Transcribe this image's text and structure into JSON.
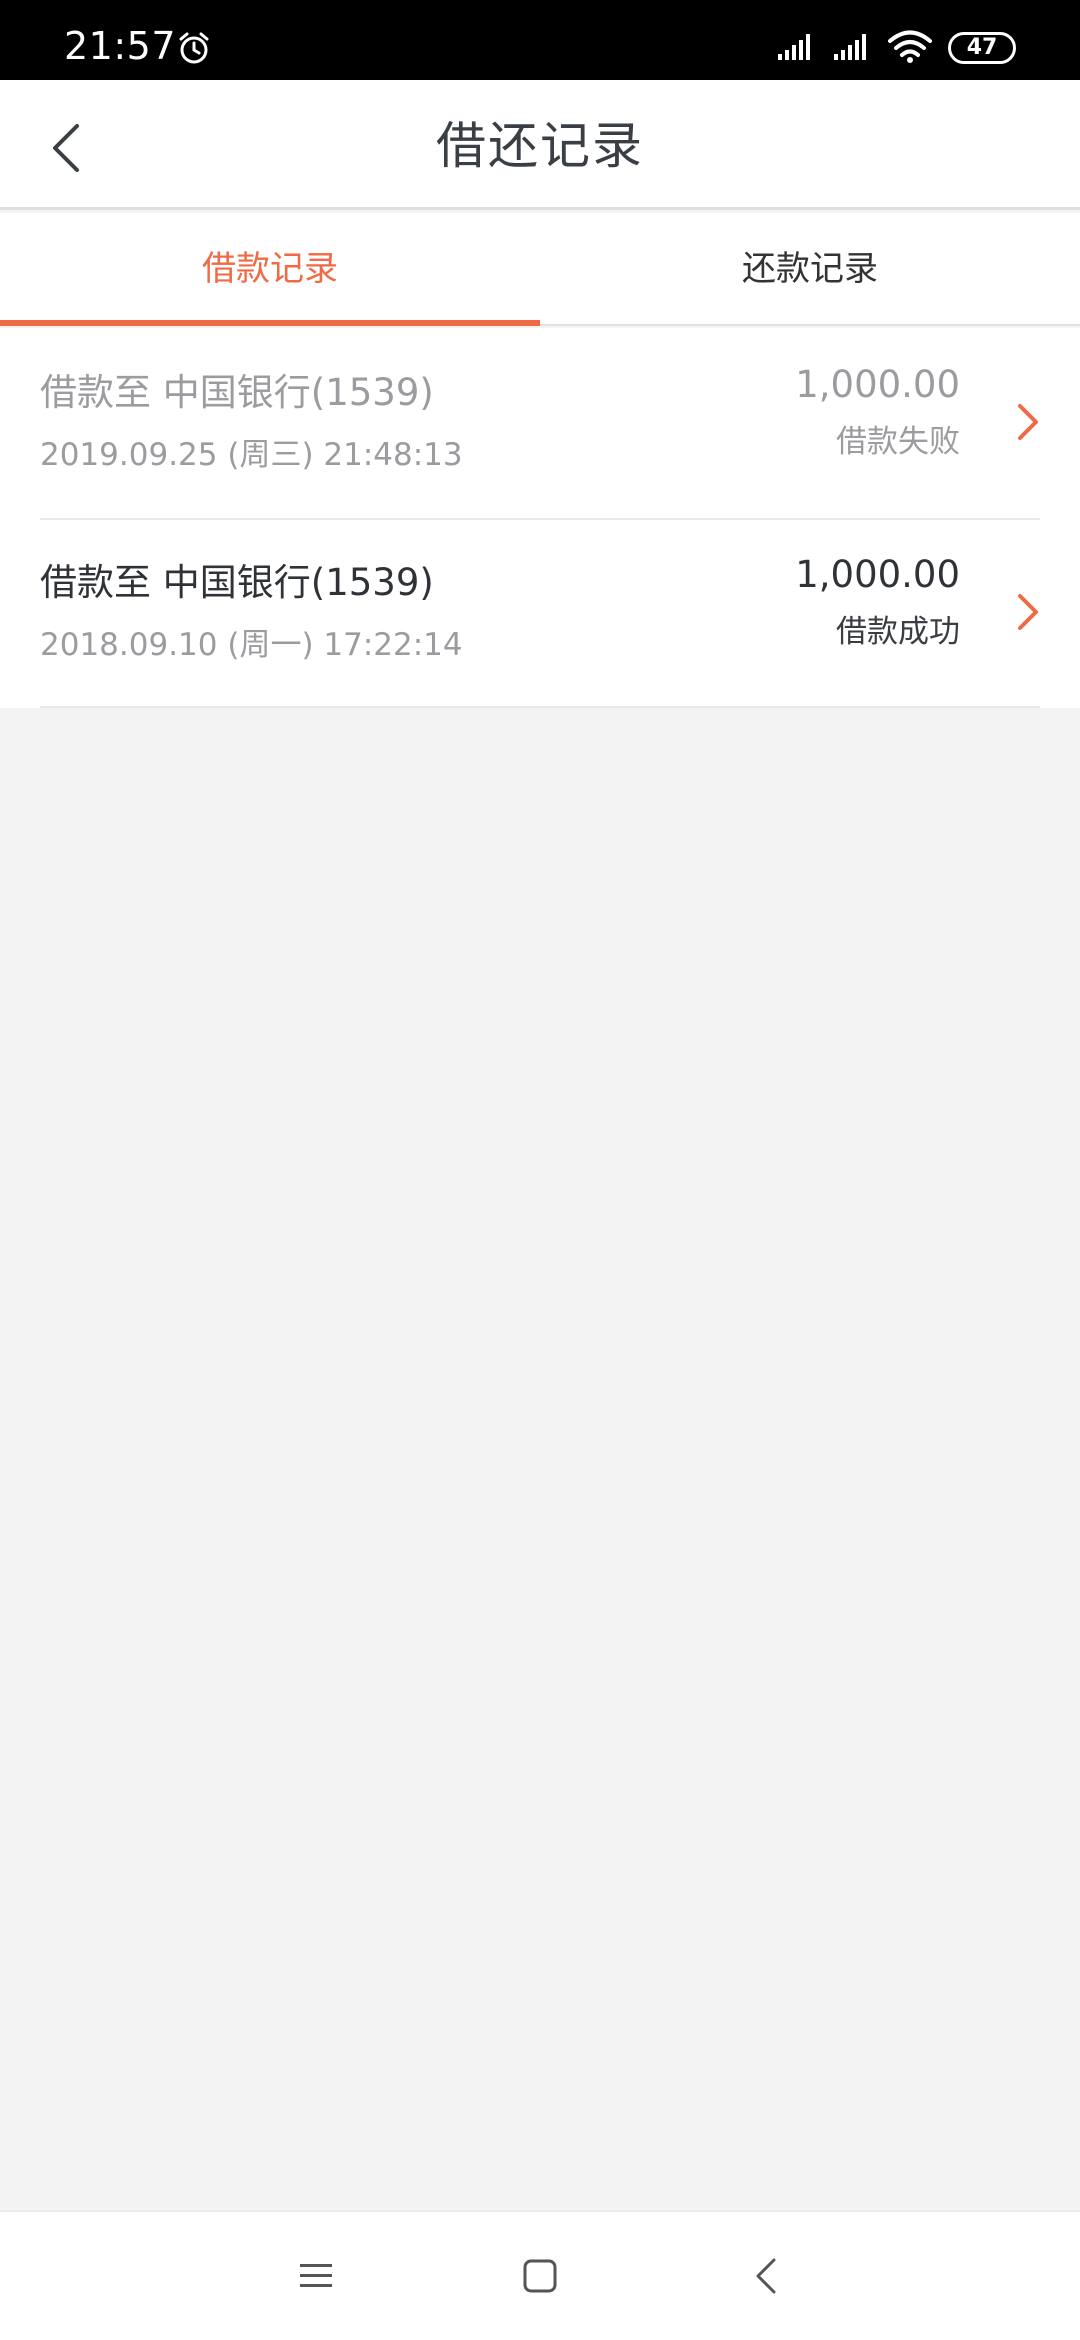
{
  "status_bar": {
    "time": "21:57",
    "battery": "47",
    "icons": [
      "alarm-icon",
      "signal-icon",
      "signal-icon",
      "wifi-icon",
      "battery-icon"
    ]
  },
  "header": {
    "title": "借还记录",
    "back_icon": "chevron-left-icon"
  },
  "tabs": [
    {
      "label": "借款记录",
      "active": true
    },
    {
      "label": "还款记录",
      "active": false
    }
  ],
  "records": [
    {
      "destination": "借款至 中国银行(1539)",
      "datetime": "2019.09.25 (周三) 21:48:13",
      "amount": "1,000.00",
      "status": "借款失败"
    },
    {
      "destination": "借款至 中国银行(1539)",
      "datetime": "2018.09.10 (周一) 17:22:14",
      "amount": "1,000.00",
      "status": "借款成功"
    }
  ],
  "nav_bar": {
    "icons": [
      "menu-icon",
      "home-icon",
      "back-icon"
    ]
  },
  "colors": {
    "accent": "#f06a46",
    "background": "#f3f3f3",
    "text_primary": "#2f3338",
    "text_secondary": "#9a9ca0"
  }
}
